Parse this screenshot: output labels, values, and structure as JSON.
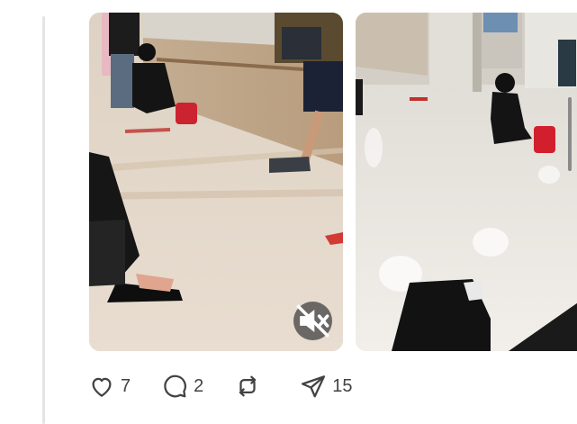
{
  "post": {
    "media": [
      {
        "kind": "video",
        "muted": true
      },
      {
        "kind": "image"
      }
    ],
    "mute_icon": "speaker-muted-icon"
  },
  "actions": {
    "like": {
      "icon": "heart-icon",
      "count": "7"
    },
    "reply": {
      "icon": "comment-bubble-icon",
      "count": "2"
    },
    "repost": {
      "icon": "repost-icon",
      "count": ""
    },
    "share": {
      "icon": "send-icon",
      "count": "15"
    }
  },
  "colors": {
    "icon": "#424242",
    "thread_line": "#e4e4e4",
    "overlay": "#464646"
  }
}
